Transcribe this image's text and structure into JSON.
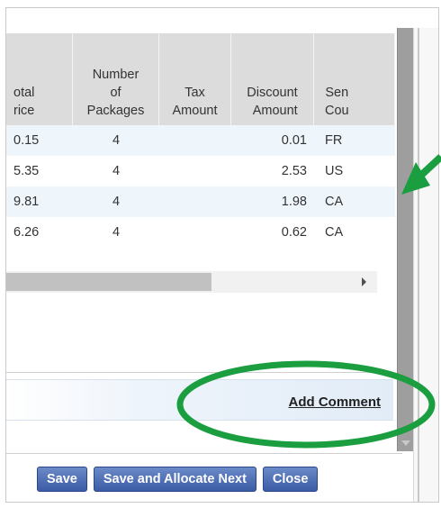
{
  "table": {
    "headers": {
      "total_price": "otal\nrice",
      "packages": "Number\nof\nPackages",
      "tax": "Tax\nAmount",
      "discount": "Discount\nAmount",
      "country": "Sen\nCou"
    },
    "rows": [
      {
        "total": "0.15",
        "packages": "4",
        "tax": "",
        "discount": "0.01",
        "country": "FR"
      },
      {
        "total": "5.35",
        "packages": "4",
        "tax": "",
        "discount": "2.53",
        "country": "US"
      },
      {
        "total": "9.81",
        "packages": "4",
        "tax": "",
        "discount": "1.98",
        "country": "CA"
      },
      {
        "total": "6.26",
        "packages": "4",
        "tax": "",
        "discount": "0.62",
        "country": "CA"
      }
    ]
  },
  "comment": {
    "link_label": "Add Comment"
  },
  "buttons": {
    "save": "Save",
    "save_allocate": "Save and Allocate Next",
    "close": "Close"
  },
  "colors": {
    "annotation": "#1a9e3f",
    "button": "#3b5ba5",
    "row_alt": "#eef5fb"
  }
}
